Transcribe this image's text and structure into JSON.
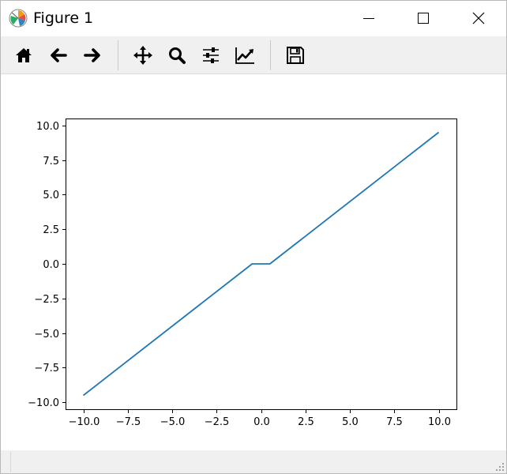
{
  "window": {
    "title": "Figure 1",
    "app_icon": "matplotlib-logo-icon",
    "controls": [
      "minimize-icon",
      "maximize-icon",
      "close-icon"
    ]
  },
  "toolbar": {
    "buttons": [
      {
        "name": "home",
        "icon": "home-icon"
      },
      {
        "name": "back",
        "icon": "arrow-left-icon"
      },
      {
        "name": "forward",
        "icon": "arrow-right-icon"
      },
      {
        "name": "pan",
        "icon": "move-icon"
      },
      {
        "name": "zoom",
        "icon": "magnifier-icon"
      },
      {
        "name": "subplots",
        "icon": "sliders-icon"
      },
      {
        "name": "customize",
        "icon": "line-chart-icon"
      },
      {
        "name": "save",
        "icon": "floppy-disk-icon"
      }
    ]
  },
  "status": {
    "text": ""
  },
  "chart_data": {
    "type": "line",
    "title": "",
    "xlabel": "",
    "ylabel": "",
    "xlim": [
      -11,
      11
    ],
    "ylim": [
      -10.5,
      10.5
    ],
    "x_ticks": [
      -10.0,
      -7.5,
      -5.0,
      -2.5,
      0.0,
      2.5,
      5.0,
      7.5,
      10.0
    ],
    "x_tick_labels": [
      "−10.0",
      "−7.5",
      "−5.0",
      "−2.5",
      "0.0",
      "2.5",
      "5.0",
      "7.5",
      "10.0"
    ],
    "y_ticks": [
      -10.0,
      -7.5,
      -5.0,
      -2.5,
      0.0,
      2.5,
      5.0,
      7.5,
      10.0
    ],
    "y_tick_labels": [
      "−10.0",
      "−7.5",
      "−5.0",
      "−2.5",
      "0.0",
      "2.5",
      "5.0",
      "7.5",
      "10.0"
    ],
    "grid": false,
    "series": [
      {
        "color": "#1f77b4",
        "x": [
          -10.0,
          -0.5,
          0.5,
          10.0
        ],
        "y": [
          -9.5,
          0.0,
          0.0,
          9.5
        ]
      }
    ]
  }
}
